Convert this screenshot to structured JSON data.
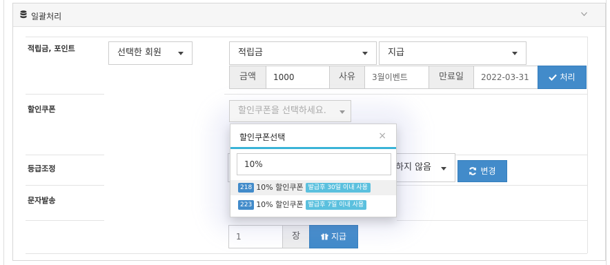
{
  "panel": {
    "title": "일괄처리"
  },
  "rows": {
    "points": "적립금, 포인트",
    "coupon": "할인쿠폰",
    "grade": "등급조정",
    "sms": "문자발송"
  },
  "points_form": {
    "target_select": "선택한 회원",
    "type_select": "적립금",
    "action_select": "지급",
    "amount_label": "금액",
    "amount_value": "1000",
    "reason_label": "사유",
    "reason_value": "3월이벤트",
    "expire_label": "만료일",
    "expire_value": "2022-03-31",
    "submit_label": "처리"
  },
  "coupon_form": {
    "select_placeholder": "할인쿠폰을 선택하세요.",
    "qty_value": "1",
    "qty_unit": "장",
    "submit_label": "지급"
  },
  "grade_form": {
    "select_partial": "하지 않음",
    "submit_label": "변경"
  },
  "coupon_popup": {
    "title": "할인쿠폰선택",
    "close": "×",
    "search_value": "10%",
    "options": [
      {
        "id": "218",
        "name": "10% 할인쿠폰",
        "tag": "발급후 30일 이내 사용"
      },
      {
        "id": "223",
        "name": "10% 할인쿠폰",
        "tag": "발급후 7일 이내 사용"
      }
    ]
  },
  "colors": {
    "primary": "#428bca",
    "info": "#5bc0de"
  }
}
